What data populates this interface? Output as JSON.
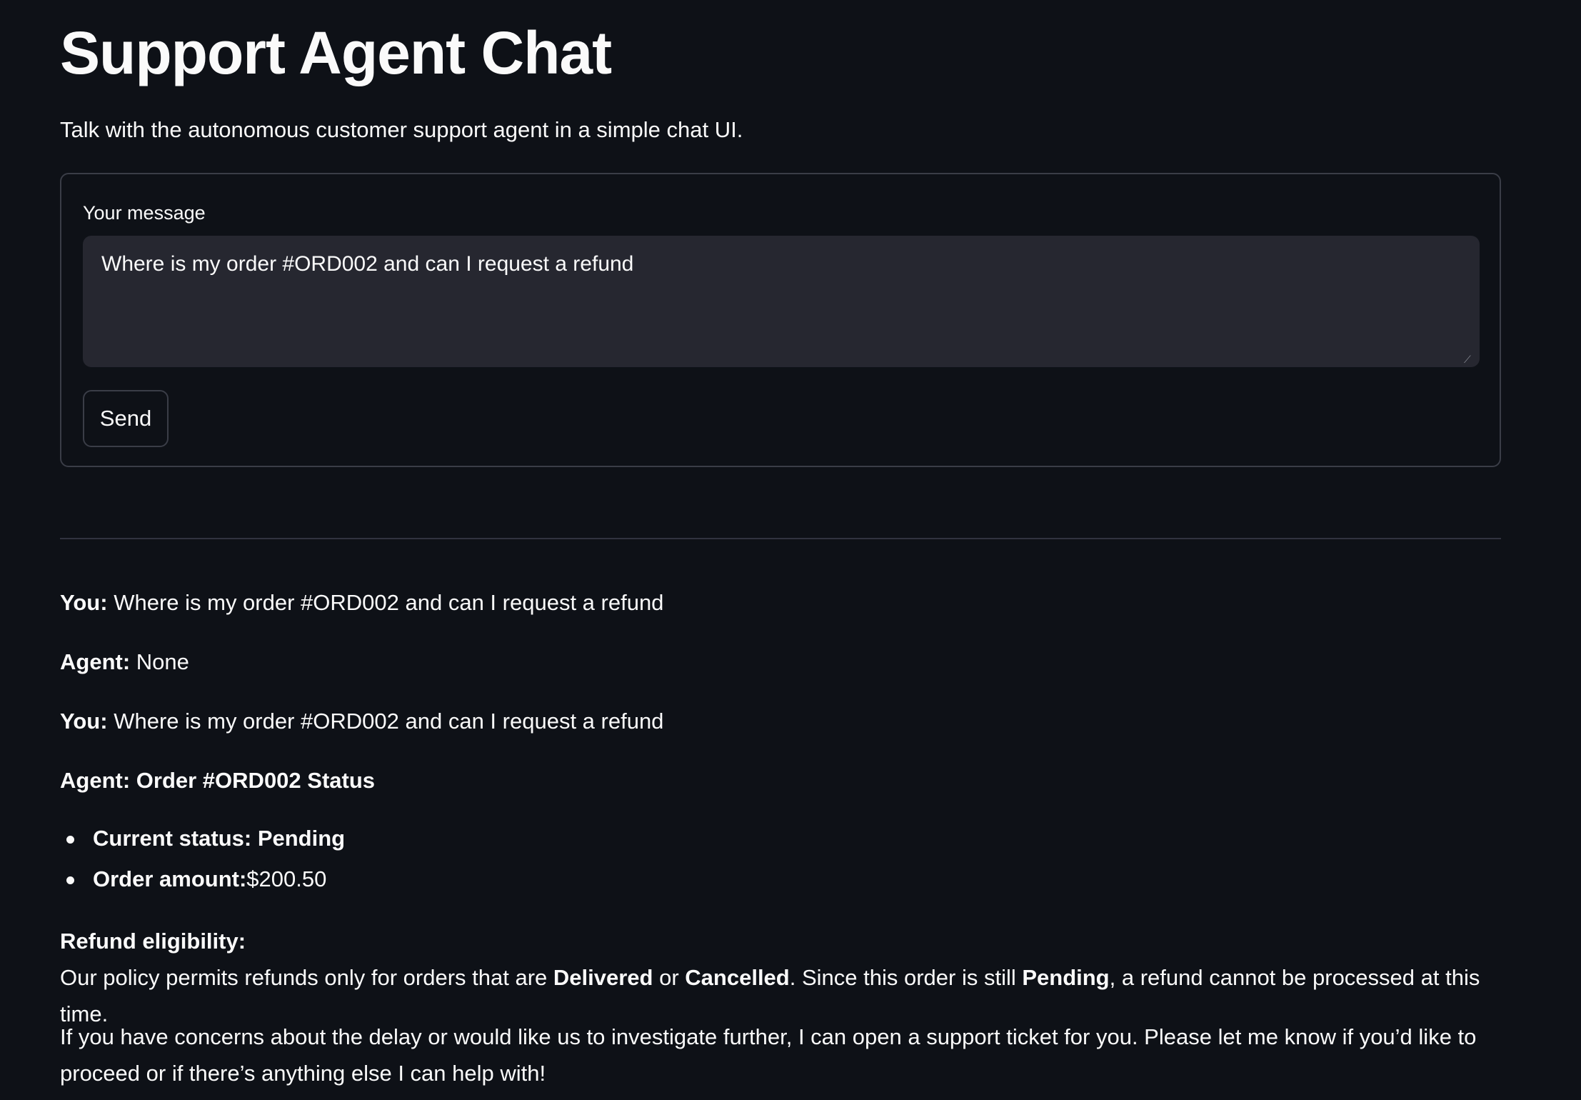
{
  "header": {
    "title": "Support Agent Chat",
    "subtitle": "Talk with the autonomous customer support agent in a simple chat UI."
  },
  "form": {
    "label": "Your message",
    "message_value": "Where is my order #ORD002 and can I request a refund",
    "send_label": "Send"
  },
  "chat": {
    "you_label": "You:",
    "agent_label": "Agent:",
    "messages": [
      {
        "text": "Where is my order #ORD002 and can I request a refund"
      },
      {
        "text": "None"
      },
      {
        "text": "Where is my order #ORD002 and can I request a refund"
      },
      {
        "heading": "Order #ORD002 Status"
      }
    ],
    "status_items": [
      {
        "label": "Current status:",
        "value": "Pending"
      },
      {
        "label": "Order amount:",
        "value": "$200.50"
      }
    ],
    "refund": {
      "heading": "Refund eligibility:",
      "text_1": "Our policy permits refunds only for orders that are ",
      "bold_1": "Delivered",
      "text_2": " or ",
      "bold_2": "Cancelled",
      "text_3": ". Since this order is still ",
      "bold_3": "Pending",
      "text_4": ", a refund cannot be processed at this time."
    },
    "closing": "If you have concerns about the delay or would like us to investigate further, I can open a support ticket for you. Please let me know if you’d like to proceed or if there’s anything else I can help with!"
  }
}
